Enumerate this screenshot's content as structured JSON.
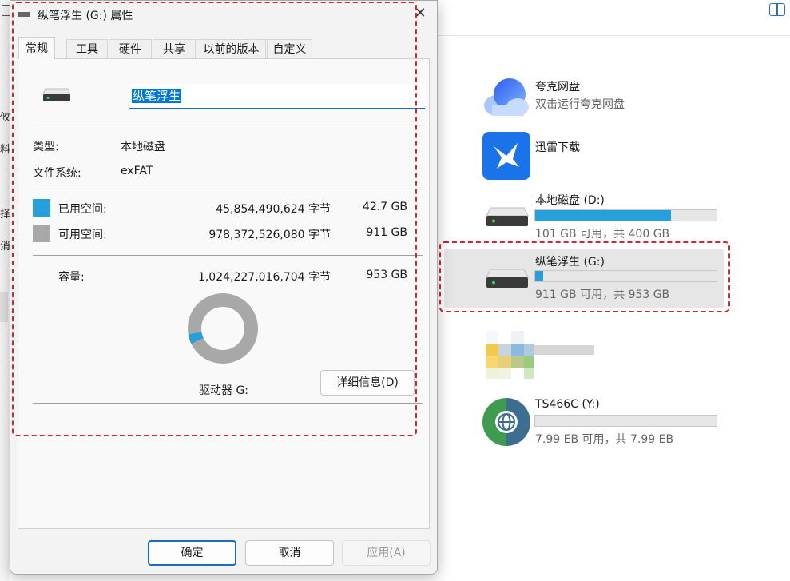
{
  "explorer": {
    "left_fragments": [
      "攸",
      "料",
      "择",
      "消"
    ],
    "items": [
      {
        "title": "夸克网盘",
        "sub": "双击运行夸克网盘",
        "icon": "quark-cloud-icon"
      },
      {
        "title": "迅雷下载",
        "icon": "xunlei-bird-icon"
      },
      {
        "title": "本地磁盘 (D:)",
        "sub": "101 GB 可用，共 400 GB",
        "used_fraction": 0.75,
        "icon": "drive-icon"
      },
      {
        "title": "纵笔浮生 (G:)",
        "sub": "911 GB 可用，共 953 GB",
        "used_fraction": 0.045,
        "icon": "drive-icon"
      },
      {
        "title": "TS466C (Y:)",
        "sub": "7.99 EB 可用，共 7.99 EB",
        "used_fraction": 0.0,
        "icon": "network-globe-icon"
      }
    ]
  },
  "dialog": {
    "title": "纵笔浮生 (G:) 属性",
    "close_label": "✕",
    "tabs": [
      "常规",
      "工具",
      "硬件",
      "共享",
      "以前的版本",
      "自定义"
    ],
    "active_tab": 0,
    "drive_name": "纵笔浮生",
    "type_label": "类型:",
    "type_value": "本地磁盘",
    "fs_label": "文件系统:",
    "fs_value": "exFAT",
    "used": {
      "label": "已用空间:",
      "bytes": "45,854,490,624 字节",
      "size": "42.7 GB",
      "color": "#26a0da"
    },
    "free": {
      "label": "可用空间:",
      "bytes": "978,372,526,080 字节",
      "size": "911 GB",
      "color": "#a8a8a8"
    },
    "capacity": {
      "label": "容量:",
      "bytes": "1,024,227,016,704 字节",
      "size": "953 GB"
    },
    "used_fraction": 0.045,
    "drive_caption": "驱动器 G:",
    "details_button": "详细信息(D)",
    "ok_button": "确定",
    "cancel_button": "取消",
    "apply_button": "应用(A)"
  },
  "colors": {
    "accent": "#1a6bc4",
    "used": "#26a0da",
    "free": "#a8a8a8",
    "highlight_border": "#d9232d"
  }
}
